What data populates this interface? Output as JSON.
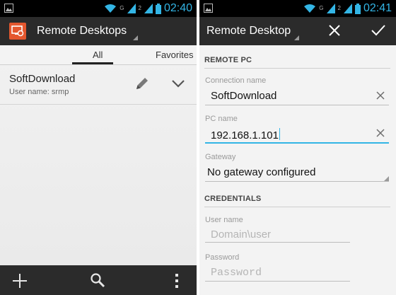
{
  "left_screen": {
    "statusbar": {
      "time": "02:40",
      "network_label": "G",
      "sim_label": "2",
      "colors": {
        "bar": "#000000",
        "accent": "#33b5e5"
      }
    },
    "actionbar": {
      "app_icon": "remote-desktop-app-icon",
      "title": "Remote Desktops",
      "colors": {
        "bar": "#2b2b2b",
        "app_icon_bg": "#e4572e"
      }
    },
    "tabs": [
      {
        "label": "All",
        "selected": true
      },
      {
        "label": "Favorites",
        "selected": false
      }
    ],
    "desktops": [
      {
        "name": "SoftDownload",
        "username_line": "User name: srmp",
        "edit_icon": "pencil-icon",
        "expand_icon": "chevron-down-icon"
      }
    ],
    "bottombar": {
      "icons": [
        "plus-icon",
        "search-icon",
        "overflow-menu-icon"
      ]
    }
  },
  "right_screen": {
    "statusbar": {
      "time": "02:41",
      "network_label": "G",
      "sim_label": "2"
    },
    "actionbar": {
      "title": "Remote Desktop",
      "cancel_icon": "close-icon",
      "save_icon": "checkmark-icon"
    },
    "sections": {
      "remote_pc": "REMOTE PC",
      "credentials": "CREDENTIALS"
    },
    "fields": {
      "connection_name": {
        "label": "Connection name",
        "value": "SoftDownload"
      },
      "pc_name": {
        "label": "PC name",
        "value": "192.168.1.101",
        "focused": true
      },
      "gateway": {
        "label": "Gateway",
        "value": "No gateway configured"
      },
      "user_name": {
        "label": "User name",
        "placeholder": "Domain\\user"
      },
      "password": {
        "label": "Password",
        "placeholder": "Password"
      }
    },
    "colors": {
      "focus": "#33b5e5",
      "label": "#9a9a9a"
    }
  }
}
